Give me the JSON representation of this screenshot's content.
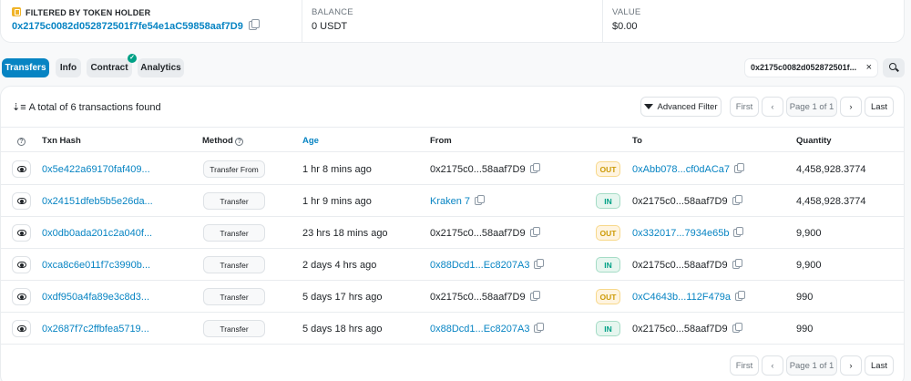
{
  "summary": {
    "filtered_title": "FILTERED BY TOKEN HOLDER",
    "holder_address": "0x2175c0082d052872501f7fe54e1aC59858aaf7D9",
    "balance_title": "BALANCE",
    "balance_value": "0 USDT",
    "value_title": "VALUE",
    "value_value": "$0.00"
  },
  "tabs": {
    "transfers": "Transfers",
    "info": "Info",
    "contract": "Contract",
    "contract_badge": "✓",
    "analytics": "Analytics"
  },
  "filter": {
    "chip_text": "0x2175c0082d052872501f...",
    "close": "×"
  },
  "list": {
    "sort_icon": "⇣≡",
    "total_text": "A total of 6 transactions found",
    "advanced_filter": "Advanced Filter"
  },
  "pagination": {
    "first": "First",
    "prev": "‹",
    "page": "Page 1 of 1",
    "next": "›",
    "last": "Last"
  },
  "columns": {
    "help": "?",
    "txn_hash": "Txn Hash",
    "method": "Method",
    "age": "Age",
    "from": "From",
    "to": "To",
    "quantity": "Quantity"
  },
  "colors": {
    "accent": "#0784c3",
    "out": "#cc9a06",
    "in": "#00a186"
  },
  "rows": [
    {
      "hash": "0x5e422a69170faf409...",
      "method": "Transfer From",
      "age": "1 hr 8 mins ago",
      "from": "0x2175c0...58aaf7D9",
      "from_link": false,
      "dir": "OUT",
      "to": "0xAbb078...cf0dACa7",
      "to_link": true,
      "qty": "4,458,928.3774"
    },
    {
      "hash": "0x24151dfeb5b5e26da...",
      "method": "Transfer",
      "age": "1 hr 9 mins ago",
      "from": "Kraken 7",
      "from_link": true,
      "dir": "IN",
      "to": "0x2175c0...58aaf7D9",
      "to_link": false,
      "qty": "4,458,928.3774"
    },
    {
      "hash": "0x0db0ada201c2a040f...",
      "method": "Transfer",
      "age": "23 hrs 18 mins ago",
      "from": "0x2175c0...58aaf7D9",
      "from_link": false,
      "dir": "OUT",
      "to": "0x332017...7934e65b",
      "to_link": true,
      "qty": "9,900"
    },
    {
      "hash": "0xca8c6e011f7c3990b...",
      "method": "Transfer",
      "age": "2 days 4 hrs ago",
      "from": "0x88Dcd1...Ec8207A3",
      "from_link": true,
      "dir": "IN",
      "to": "0x2175c0...58aaf7D9",
      "to_link": false,
      "qty": "9,900"
    },
    {
      "hash": "0xdf950a4fa89e3c8d3...",
      "method": "Transfer",
      "age": "5 days 17 hrs ago",
      "from": "0x2175c0...58aaf7D9",
      "from_link": false,
      "dir": "OUT",
      "to": "0xC4643b...112F479a",
      "to_link": true,
      "qty": "990"
    },
    {
      "hash": "0x2687f7c2ffbfea5719...",
      "method": "Transfer",
      "age": "5 days 18 hrs ago",
      "from": "0x88Dcd1...Ec8207A3",
      "from_link": true,
      "dir": "IN",
      "to": "0x2175c0...58aaf7D9",
      "to_link": false,
      "qty": "990"
    }
  ]
}
